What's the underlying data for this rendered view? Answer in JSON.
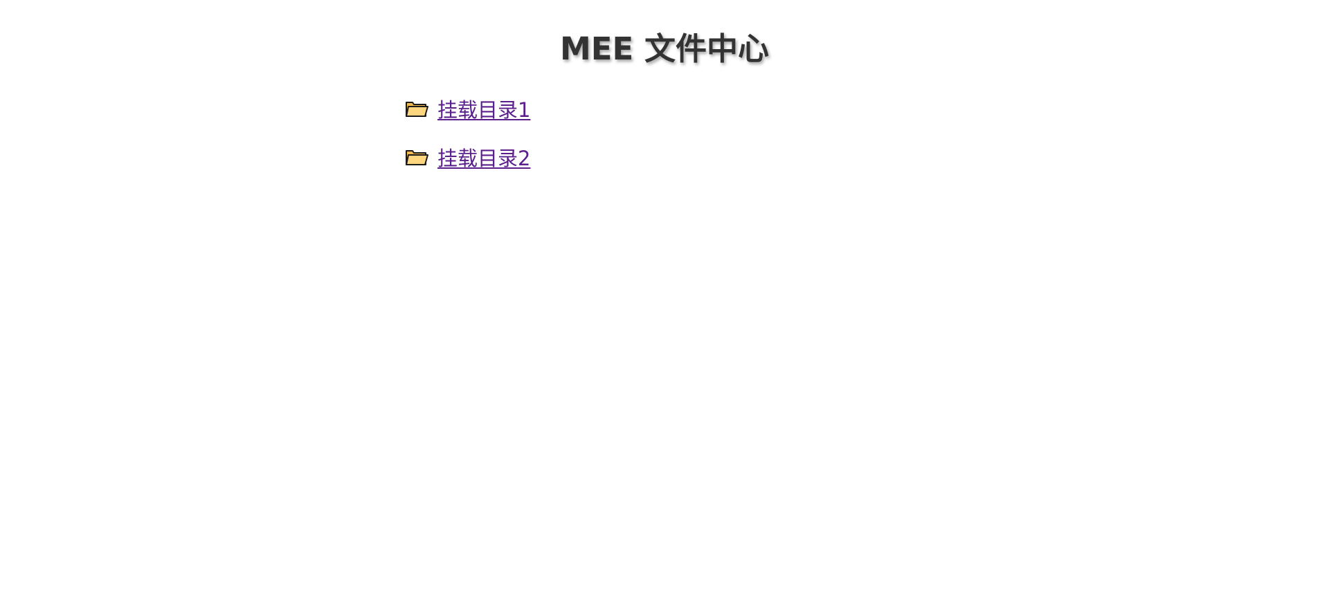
{
  "header": {
    "title": "MEE 文件中心"
  },
  "folders": [
    {
      "label": "挂载目录1",
      "icon": "folder-icon"
    },
    {
      "label": "挂载目录2",
      "icon": "folder-icon"
    }
  ],
  "colors": {
    "title": "#333333",
    "link_visited": "#5b1f8c",
    "folder_fill": "#ffd680",
    "folder_stroke": "#1a1a1a"
  }
}
